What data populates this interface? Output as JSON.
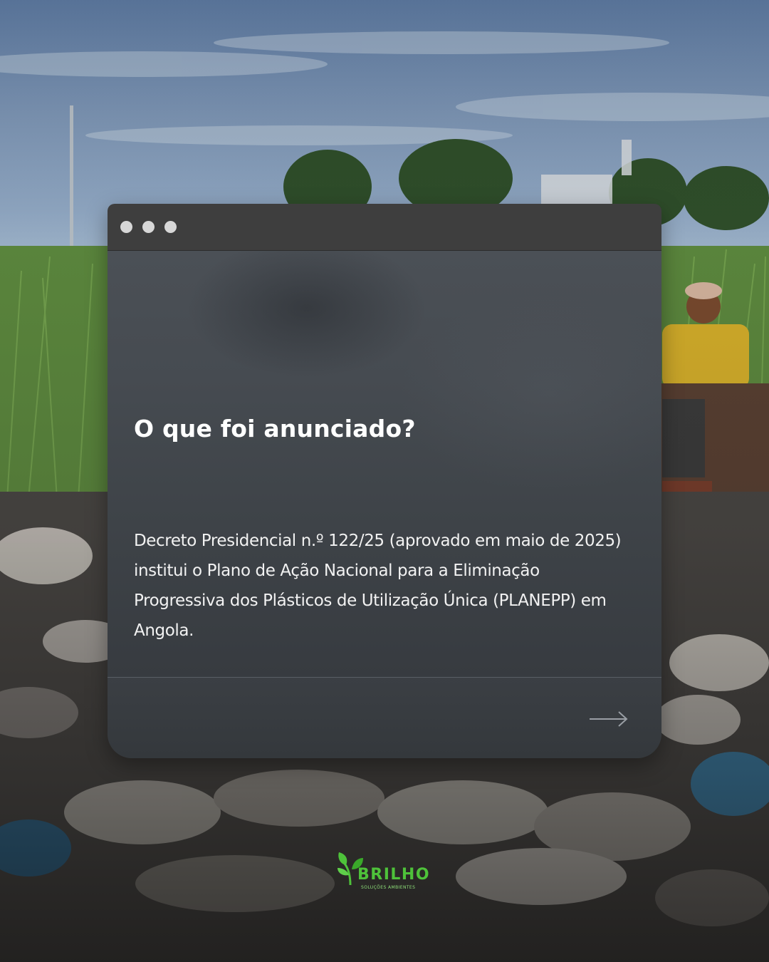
{
  "card": {
    "heading": "O que foi anunciado?",
    "body": "Decreto Presidencial n.º 122/25 (aprovado em maio de 2025) institui o Plano de Ação Nacional para a Eliminação Progressiva dos Plásticos de Utilização Única (PLANEPP) em Angola.",
    "next_icon": "arrow-right-icon"
  },
  "brand": {
    "name": "BRILHO",
    "tagline": "SOLUÇÕES AMBIENTES",
    "logo_icon": "leaf-icon",
    "color": "#4ec23a"
  },
  "colors": {
    "window_bar": "#3e3e3e",
    "window_dot": "#d7d7d7",
    "card_body": "#44494f"
  }
}
